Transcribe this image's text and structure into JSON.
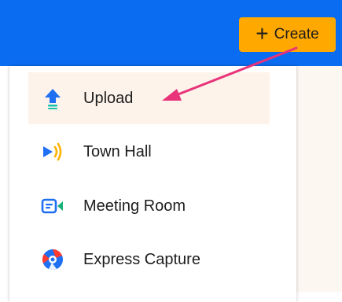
{
  "header": {
    "create_button": {
      "icon": "plus-icon",
      "label": "Create",
      "color": "#ffa800"
    },
    "bar_color": "#0a6cf0"
  },
  "menu": {
    "items": [
      {
        "id": "upload",
        "label": "Upload",
        "icon": "upload-icon",
        "active": true
      },
      {
        "id": "town-hall",
        "label": "Town Hall",
        "icon": "broadcast-icon"
      },
      {
        "id": "meeting-room",
        "label": "Meeting Room",
        "icon": "video-camera-icon"
      },
      {
        "id": "express-capture",
        "label": "Express Capture",
        "icon": "camera-aperture-icon"
      }
    ]
  },
  "annotation": {
    "type": "arrow",
    "color": "#e8337a",
    "from": "create-button",
    "to": "menu-item-upload"
  }
}
